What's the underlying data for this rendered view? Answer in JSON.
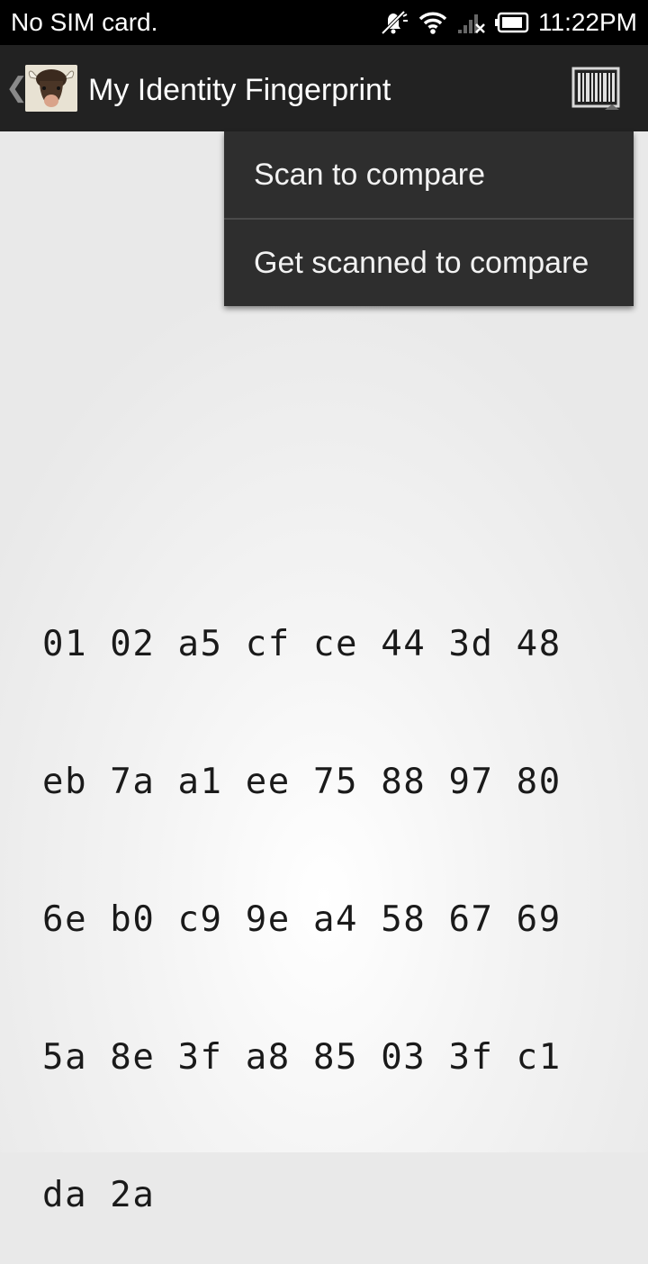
{
  "status_bar": {
    "carrier": "No SIM card.",
    "time": "11:22PM",
    "icons": [
      "muted-alarm-icon",
      "wifi-icon",
      "no-signal-icon",
      "battery-icon"
    ]
  },
  "action_bar": {
    "title": "My Identity Fingerprint",
    "up_icon": "chevron-left-icon",
    "app_icon": "bison-icon",
    "action_icon": "barcode-icon"
  },
  "menu": {
    "items": [
      {
        "label": "Scan to compare"
      },
      {
        "label": "Get scanned to compare"
      }
    ]
  },
  "fingerprint": {
    "lines": [
      "01 02 a5 cf ce 44 3d 48",
      "eb 7a a1 ee 75 88 97 80",
      "6e b0 c9 9e a4 58 67 69",
      "5a 8e 3f a8 85 03 3f c1",
      "da 2a"
    ]
  },
  "colors": {
    "status_bar_bg": "#000000",
    "action_bar_bg": "#222222",
    "menu_bg": "#2e2e2e",
    "text_dark": "#1a1a1a"
  }
}
